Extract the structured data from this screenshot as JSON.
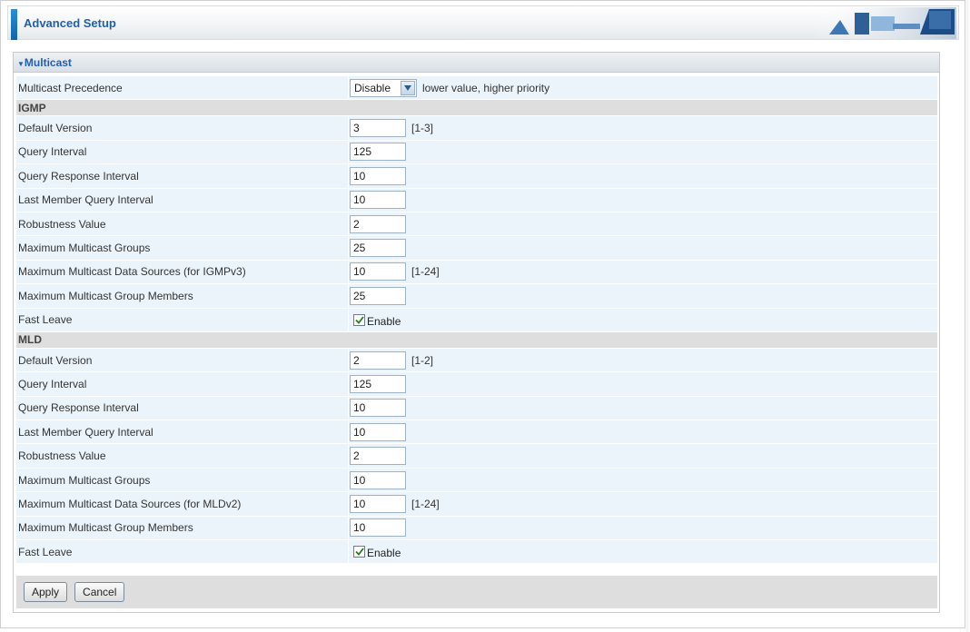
{
  "header": {
    "title": "Advanced Setup"
  },
  "section": {
    "title": "Multicast"
  },
  "precedence": {
    "label": "Multicast Precedence",
    "selected": "Disable",
    "hint": "lower value, higher priority"
  },
  "igmp": {
    "group_label": "IGMP",
    "rows": [
      {
        "label": "Default Version",
        "value": "3",
        "hint": "[1-3]"
      },
      {
        "label": "Query Interval",
        "value": "125",
        "hint": ""
      },
      {
        "label": "Query Response Interval",
        "value": "10",
        "hint": ""
      },
      {
        "label": "Last Member Query Interval",
        "value": "10",
        "hint": ""
      },
      {
        "label": "Robustness Value",
        "value": "2",
        "hint": ""
      },
      {
        "label": "Maximum Multicast Groups",
        "value": "25",
        "hint": ""
      },
      {
        "label": "Maximum Multicast Data Sources (for IGMPv3)",
        "value": "10",
        "hint": "[1-24]"
      },
      {
        "label": "Maximum Multicast Group Members",
        "value": "25",
        "hint": ""
      }
    ],
    "fast_leave": {
      "label": "Fast Leave",
      "checkbox_label": "Enable",
      "checked": true
    }
  },
  "mld": {
    "group_label": "MLD",
    "rows": [
      {
        "label": "Default Version",
        "value": "2",
        "hint": "[1-2]"
      },
      {
        "label": "Query Interval",
        "value": "125",
        "hint": ""
      },
      {
        "label": "Query Response Interval",
        "value": "10",
        "hint": ""
      },
      {
        "label": "Last Member Query Interval",
        "value": "10",
        "hint": ""
      },
      {
        "label": "Robustness Value",
        "value": "2",
        "hint": ""
      },
      {
        "label": "Maximum Multicast Groups",
        "value": "10",
        "hint": ""
      },
      {
        "label": "Maximum Multicast Data Sources (for MLDv2)",
        "value": "10",
        "hint": "[1-24]"
      },
      {
        "label": "Maximum Multicast Group Members",
        "value": "10",
        "hint": ""
      }
    ],
    "fast_leave": {
      "label": "Fast Leave",
      "checkbox_label": "Enable",
      "checked": true
    }
  },
  "buttons": {
    "apply": "Apply",
    "cancel": "Cancel"
  },
  "colors": {
    "accent": "#1f5fb0",
    "row_bg": "#ebf4fb",
    "group_bg": "#dedede"
  },
  "icons": {
    "section_toggle": "triangle-down-icon",
    "select_arrow": "chevron-down-icon",
    "checkbox": "check-icon"
  }
}
